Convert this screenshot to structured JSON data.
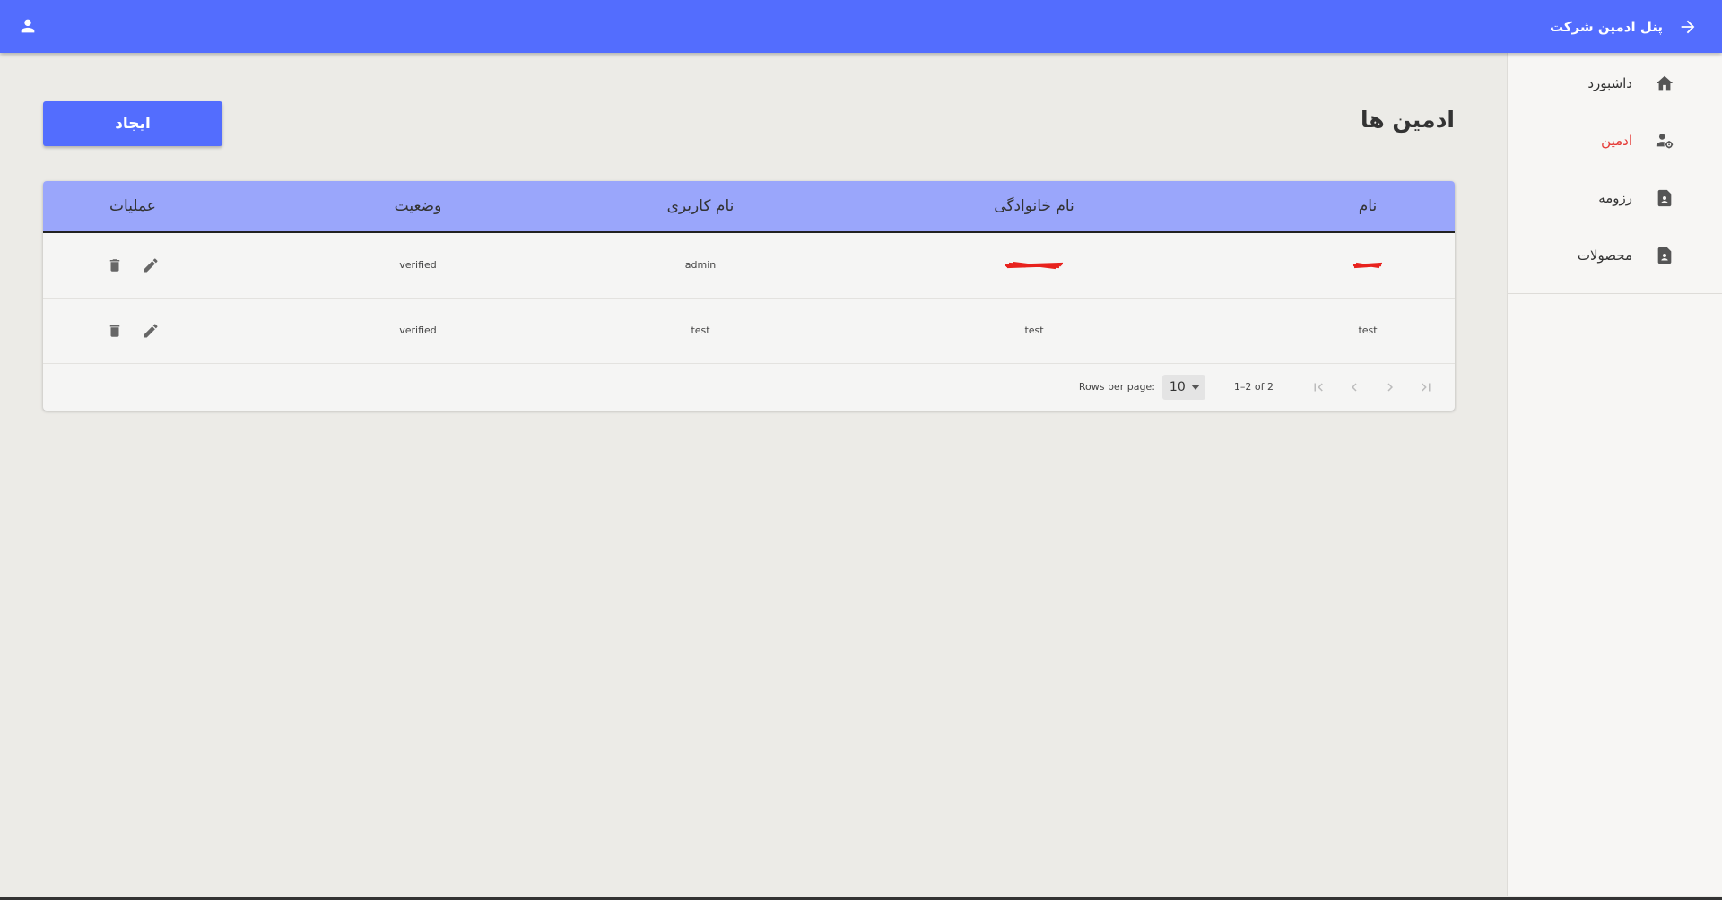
{
  "appbar": {
    "title": "پنل ادمین شرکت",
    "back_icon": "arrow-forward-icon",
    "user_icon": "person-icon",
    "color": "#536dfe"
  },
  "sidebar": {
    "items": [
      {
        "label": "داشبورد",
        "icon": "home-icon",
        "active": false
      },
      {
        "label": "ادمین",
        "icon": "admin-settings-icon",
        "active": true
      },
      {
        "label": "رزومه",
        "icon": "document-person-icon",
        "active": false
      },
      {
        "label": "محصولات",
        "icon": "document-person-icon",
        "active": false
      }
    ],
    "active_color": "#e53935"
  },
  "page": {
    "title": "ادمین ها",
    "create_label": "ایجاد"
  },
  "table": {
    "headers": {
      "name": "نام",
      "family": "نام خانوادگی",
      "username": "نام کاربری",
      "status": "وضعیت",
      "operations": "عملیات"
    },
    "rows": [
      {
        "name": "",
        "family": "",
        "username": "admin",
        "status": "verified",
        "redacted": true
      },
      {
        "name": "test",
        "family": "test",
        "username": "test",
        "status": "verified",
        "redacted": false
      }
    ],
    "header_color": "#9aa6fb"
  },
  "pagination": {
    "rows_per_page_label": "Rows per page:",
    "rows_per_page": "10",
    "range": "1–2 of 2"
  }
}
